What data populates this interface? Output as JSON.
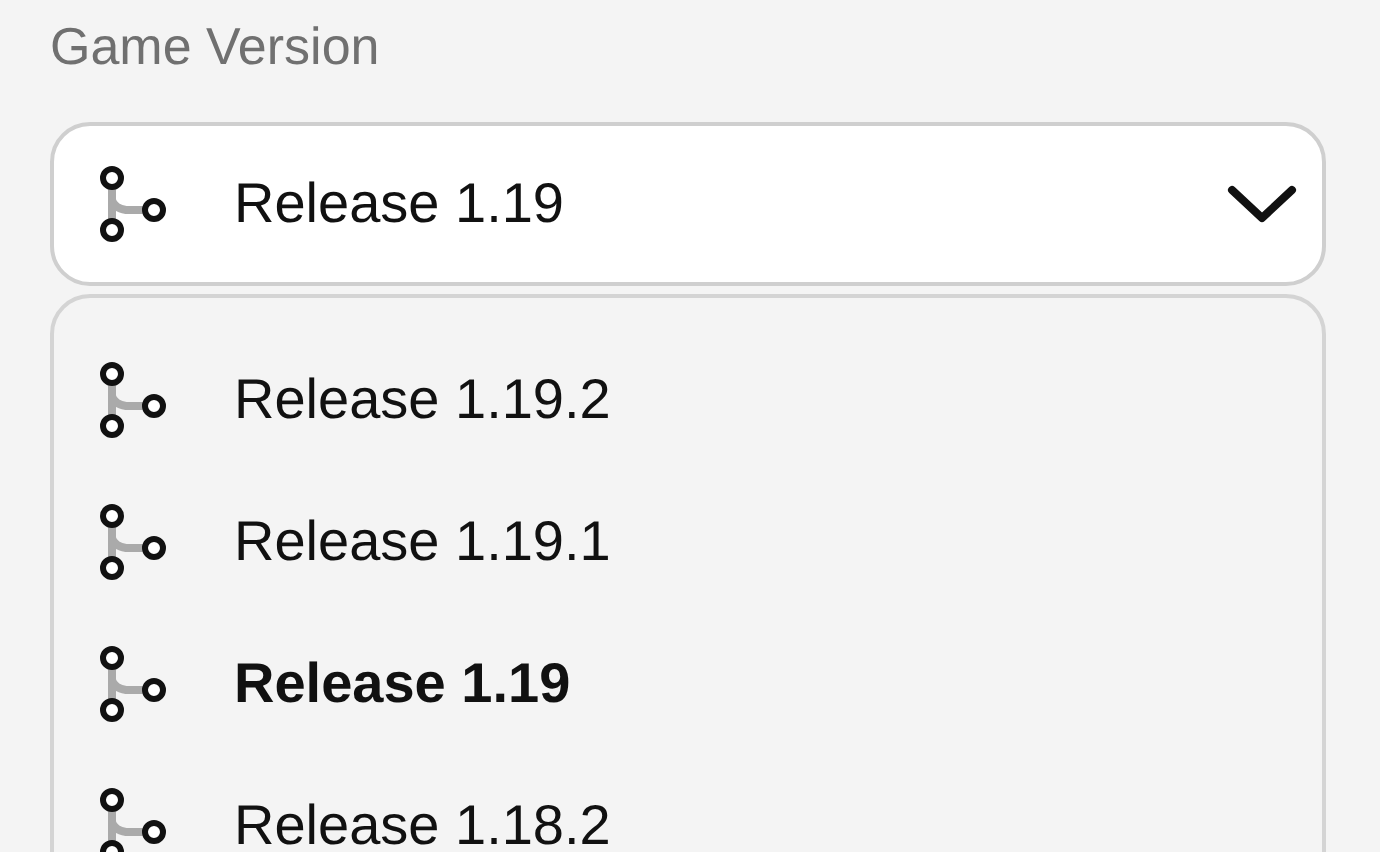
{
  "label": "Game Version",
  "select": {
    "value": "Release 1.19",
    "expanded": true
  },
  "options": [
    {
      "label": "Release 1.19.2",
      "selected": false
    },
    {
      "label": "Release 1.19.1",
      "selected": false
    },
    {
      "label": "Release 1.19",
      "selected": true
    },
    {
      "label": "Release 1.18.2",
      "selected": false
    }
  ]
}
